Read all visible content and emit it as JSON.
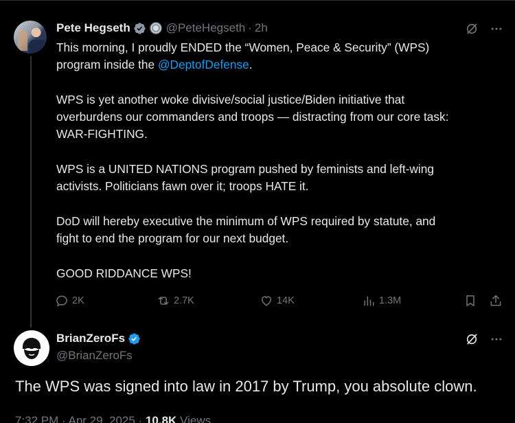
{
  "tweet": {
    "author_name": "Pete Hegseth",
    "handle": "@PeteHegseth",
    "separator": "·",
    "time": "2h",
    "lines": [
      {
        "text": "This morning, I proudly ENDED the “Women, Peace & Security” (WPS)"
      },
      {
        "text": "program inside the ",
        "mention": "@DeptofDefense",
        "after": "."
      },
      {
        "text": ""
      },
      {
        "text": "WPS is yet another woke divisive/social justice/Biden initiative that"
      },
      {
        "text": "overburdens our commanders and troops — distracting from our core task:"
      },
      {
        "text": "WAR-FIGHTING."
      },
      {
        "text": ""
      },
      {
        "text": "WPS is a UNITED NATIONS program pushed by feminists and left-wing"
      },
      {
        "text": "activists. Politicians fawn over it; troops HATE it."
      },
      {
        "text": ""
      },
      {
        "text": "DoD will hereby executive the minimum of WPS required by statute, and"
      },
      {
        "text": "fight to end the program for our next budget."
      },
      {
        "text": ""
      },
      {
        "text": "GOOD RIDDANCE WPS!"
      }
    ],
    "actions": {
      "replies": "2K",
      "reposts": "2.7K",
      "likes": "14K",
      "views": "1.3M"
    }
  },
  "reply": {
    "author_name": "BrianZeroFs",
    "handle": "@BrianZeroFs",
    "text": "The WPS was signed into law in 2017 by Trump, you absolute clown.",
    "meta_time": "7:32 PM · Apr 29, 2025 · ",
    "meta_views_count": "10.8K",
    "meta_views_label": " Views"
  },
  "colors": {
    "background": "#000000",
    "text": "#e7e9ea",
    "muted": "#71767b",
    "link": "#1d9bf0",
    "verified": "#1d9bf0"
  },
  "icons": [
    "verified-icon",
    "gov-badge-icon",
    "grok-icon",
    "more-icon",
    "reply-icon",
    "repost-icon",
    "like-icon",
    "views-icon",
    "bookmark-icon",
    "share-icon"
  ]
}
